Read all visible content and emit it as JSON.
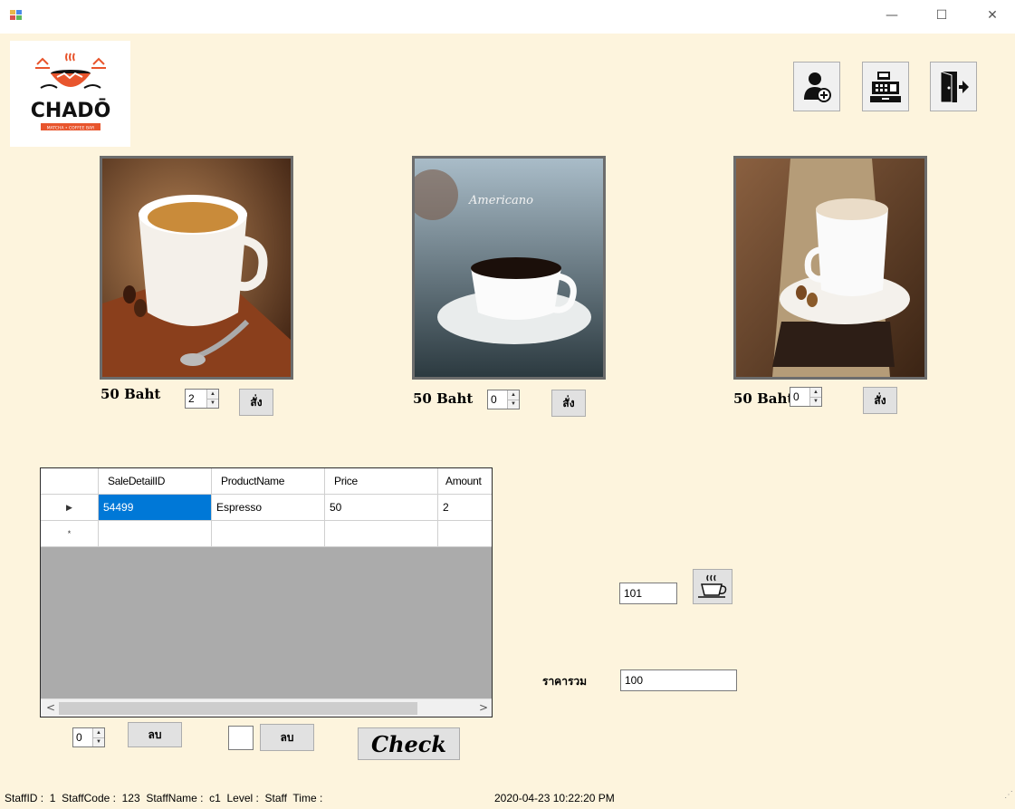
{
  "window": {
    "minimize": "—",
    "maximize": "☐",
    "close": "✕"
  },
  "logo": {
    "text": "CHADŌ",
    "subtext": "MATCHA • COFFEE BAR"
  },
  "toolbar": {
    "icons": [
      "add-user-icon",
      "cash-register-icon",
      "exit-door-icon"
    ]
  },
  "products": [
    {
      "image_text": "",
      "price": "50  Baht",
      "qty": "2",
      "order_label": "สั่ง"
    },
    {
      "image_text": "Americano",
      "price": "50  Baht",
      "qty": "0",
      "order_label": "สั่ง"
    },
    {
      "image_text": "",
      "price": "50  Baht",
      "qty": "0",
      "order_label": "สั่ง"
    }
  ],
  "grid": {
    "columns": [
      "SaleDetailID",
      "ProductName",
      "Price",
      "Amount"
    ],
    "rows": [
      {
        "marker": "▶",
        "cells": [
          "54499",
          "Espresso",
          "50",
          "2"
        ]
      },
      {
        "marker": "*",
        "cells": [
          "",
          "",
          "",
          ""
        ]
      }
    ],
    "scroll_left": "<",
    "scroll_right": ">"
  },
  "bottom": {
    "delete_qty": "0",
    "delete_label_1": "ลบ",
    "delete_id": "",
    "delete_label_2": "ลบ",
    "check_label": "Check"
  },
  "table_no": "101",
  "total": {
    "label": "ราคารวม",
    "value": "100"
  },
  "status": {
    "line": "StaffID :  1  StaffCode :  123  StaffName :  c1  Level :  Staff  Time :",
    "time": "2020-04-23 10:22:20 PM"
  }
}
